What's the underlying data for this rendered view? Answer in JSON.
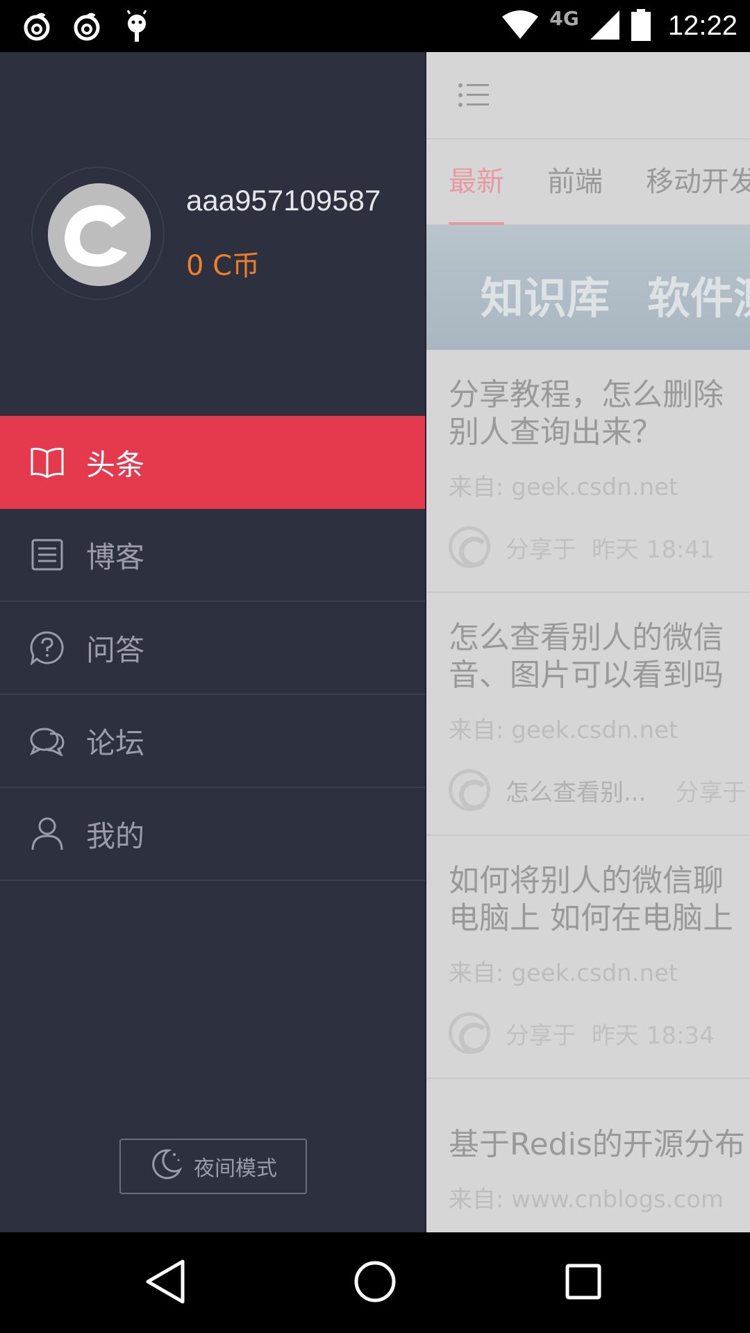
{
  "status_bar": {
    "time": "12:22",
    "network": "4G",
    "left_icons": [
      "netease-music-icon",
      "netease-music-icon",
      "android-debug-icon"
    ]
  },
  "drawer": {
    "username": "aaa957109587",
    "coins": "0 C币",
    "menu": [
      {
        "label": "头条",
        "icon": "book-icon",
        "active": true
      },
      {
        "label": "博客",
        "icon": "document-icon",
        "active": false
      },
      {
        "label": "问答",
        "icon": "question-icon",
        "active": false
      },
      {
        "label": "论坛",
        "icon": "chat-bubbles-icon",
        "active": false
      },
      {
        "label": "我的",
        "icon": "person-icon",
        "active": false
      }
    ],
    "night_mode_label": "夜间模式"
  },
  "main": {
    "tabs": [
      "最新",
      "前端",
      "移动开发"
    ],
    "banner_text": [
      "知识库",
      "软件测"
    ],
    "articles": [
      {
        "title_lines": [
          "分享教程，怎么删除",
          "别人查询出来？"
        ],
        "source_prefix": "来自:",
        "source": "geek.csdn.net",
        "share_prefix": "分享于",
        "time": "昨天 18:41",
        "extra": ""
      },
      {
        "title_lines": [
          "怎么查看别人的微信",
          "音、图片可以看到吗"
        ],
        "source_prefix": "来自:",
        "source": "geek.csdn.net",
        "share_prefix": "分享于",
        "time": "",
        "extra": "怎么查看别..."
      },
      {
        "title_lines": [
          "如何将别人的微信聊",
          "电脑上 如何在电脑上"
        ],
        "source_prefix": "来自:",
        "source": "geek.csdn.net",
        "share_prefix": "分享于",
        "time": "昨天 18:34",
        "extra": ""
      },
      {
        "title_lines": [
          "基于Redis的开源分布"
        ],
        "source_prefix": "来自:",
        "source": "www.cnblogs.com",
        "share_prefix": "",
        "time": "",
        "extra": ""
      }
    ]
  },
  "colors": {
    "drawer_bg": "#2c303f",
    "active_item": "#e5394e",
    "coin_orange": "#f07e2a",
    "tab_active": "#e79aa2"
  }
}
